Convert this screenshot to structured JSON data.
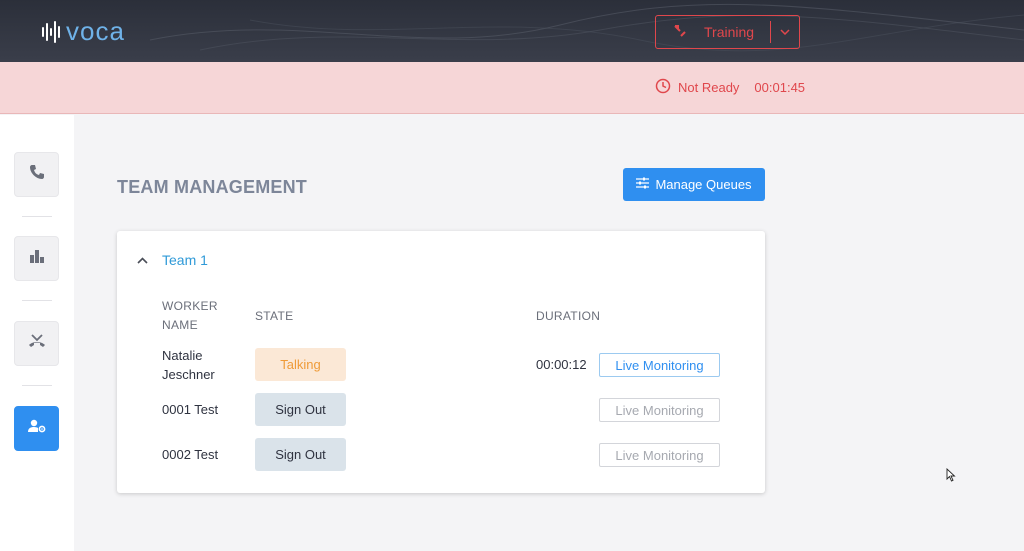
{
  "header": {
    "logo_text": "voca",
    "status_select": {
      "label": "Training",
      "icon": "phone-status-icon",
      "color": "#e0474c"
    }
  },
  "banner": {
    "status": "Not Ready",
    "timer": "00:01:45",
    "icon": "clock-icon"
  },
  "sidebar": {
    "items": [
      {
        "name": "calls",
        "icon": "phone-icon",
        "active": false
      },
      {
        "name": "reports",
        "icon": "bar-chart-icon",
        "active": false
      },
      {
        "name": "missed-calls",
        "icon": "missed-call-icon",
        "active": false
      },
      {
        "name": "team-management",
        "icon": "user-gear-icon",
        "active": true
      }
    ]
  },
  "main": {
    "title": "TEAM MANAGEMENT",
    "manage_queues_label": "Manage Queues",
    "team": {
      "name": "Team 1",
      "columns": {
        "worker_line1": "WORKER",
        "worker_line2": "NAME",
        "state": "STATE",
        "duration": "DURATION"
      },
      "rows": [
        {
          "name_line1": "Natalie",
          "name_line2": "Jeschner",
          "state": "Talking",
          "duration": "00:00:12",
          "monitor_label": "Live Monitoring",
          "monitor_enabled": true
        },
        {
          "name_line1": "0001 Test",
          "name_line2": "",
          "state": "Sign Out",
          "duration": "",
          "monitor_label": "Live Monitoring",
          "monitor_enabled": false
        },
        {
          "name_line1": "0002 Test",
          "name_line2": "",
          "state": "Sign Out",
          "duration": "",
          "monitor_label": "Live Monitoring",
          "monitor_enabled": false
        }
      ]
    }
  },
  "colors": {
    "accent": "#2f8ff0",
    "danger": "#e0474c",
    "talking": "#ef9b38",
    "header_bg": "#2b2f3a"
  }
}
